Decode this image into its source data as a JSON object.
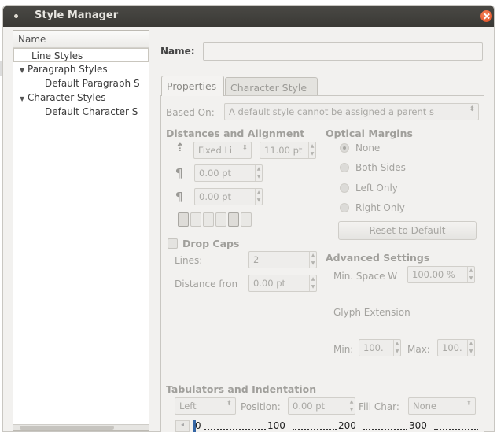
{
  "window": {
    "title": "Style Manager"
  },
  "tree": {
    "header": "Name",
    "items": [
      {
        "label": "Line Styles",
        "level": 1,
        "selected": true
      },
      {
        "label": "Paragraph Styles",
        "level": 0,
        "expanded": true
      },
      {
        "label": "Default Paragraph S",
        "level": 2
      },
      {
        "label": "Character Styles",
        "level": 0,
        "expanded": true
      },
      {
        "label": "Default Character S",
        "level": 2
      }
    ]
  },
  "name_row": {
    "label": "Name:",
    "value": ""
  },
  "tabs": [
    {
      "label": "Properties",
      "active": true
    },
    {
      "label": "Character Style",
      "active": false
    }
  ],
  "based_on": {
    "label": "Based On:",
    "value": "A default style cannot be assigned a parent s"
  },
  "distances": {
    "title": "Distances and Alignment",
    "line_spacing_mode": "Fixed Li",
    "line_spacing_value": "11.00 pt",
    "space_above": "0.00 pt",
    "space_below": "0.00 pt"
  },
  "optical_margins": {
    "title": "Optical Margins",
    "options": [
      "None",
      "Both Sides",
      "Left Only",
      "Right Only"
    ],
    "selected": "None",
    "reset_label": "Reset to Default"
  },
  "drop_caps": {
    "label": "Drop Caps",
    "checked": false,
    "lines_label": "Lines:",
    "lines_value": "2",
    "distance_label": "Distance fron",
    "distance_value": "0.00 pt"
  },
  "advanced": {
    "title": "Advanced Settings",
    "min_space_label": "Min. Space W",
    "min_space_value": "100.00 %",
    "glyph_label": "Glyph Extension",
    "min_label": "Min:",
    "min_value": "100.",
    "max_label": "Max:",
    "max_value": "100."
  },
  "tabulators": {
    "title": "Tabulators and Indentation",
    "alignment": "Left",
    "position_label": "Position:",
    "position_value": "0.00 pt",
    "fill_label": "Fill Char:",
    "fill_value": "None",
    "ruler_labels": [
      "0",
      "100",
      "200",
      "300"
    ]
  }
}
